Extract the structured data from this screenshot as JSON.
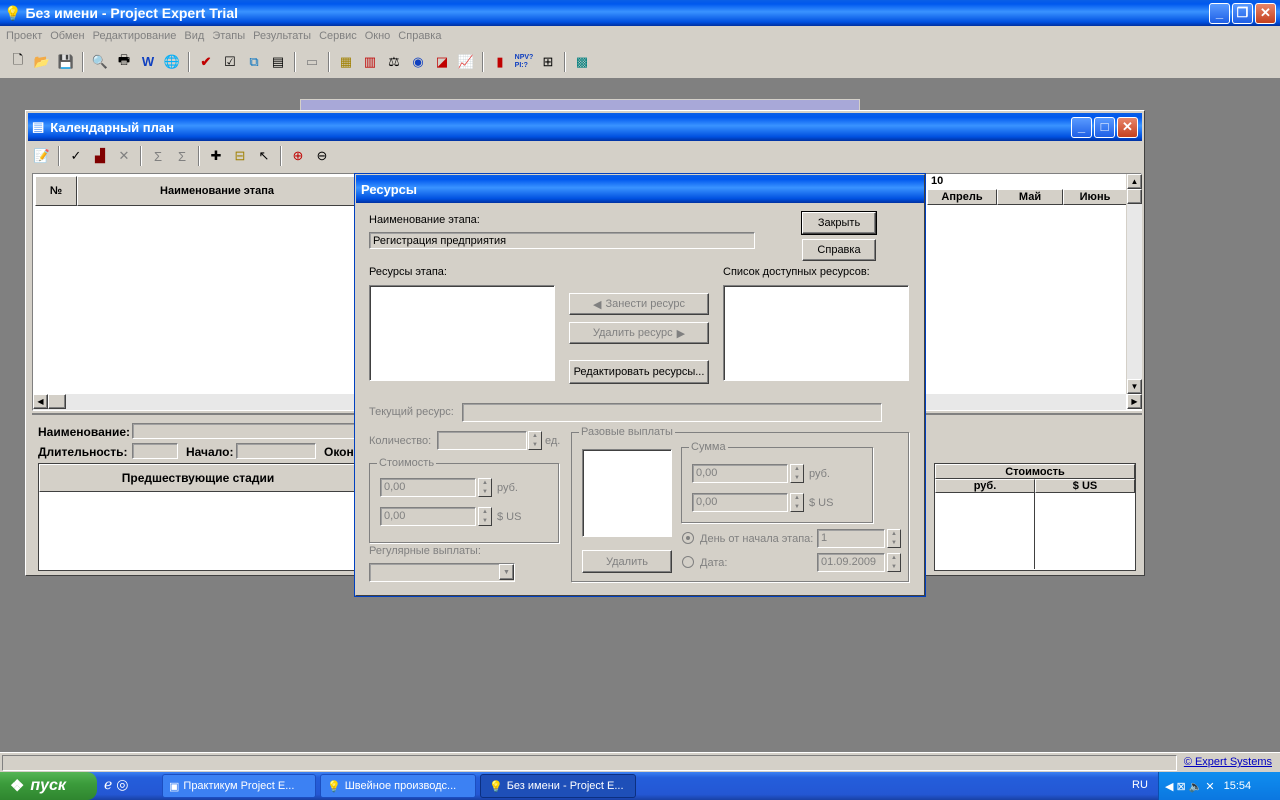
{
  "app": {
    "title": "Без имени - Project Expert Trial"
  },
  "menu": [
    "Проект",
    "Обмен",
    "Редактирование",
    "Вид",
    "Этапы",
    "Результаты",
    "Сервис",
    "Окно",
    "Справка"
  ],
  "calendar": {
    "title": "Календарный план",
    "col_num": "№",
    "col_name": "Наименование этапа",
    "year_fragment": "10",
    "months": [
      "Апрель",
      "Май",
      "Июнь"
    ],
    "name_label": "Наименование:",
    "duration_label": "Длительность:",
    "start_label": "Начало:",
    "end_label_fragment": "Окон",
    "pred_header": "Предшествующие стадии",
    "cost_header": "Стоимость",
    "cost_rub": "руб.",
    "cost_usd": "$ US"
  },
  "resources": {
    "title": "Ресурсы",
    "stage_name_label": "Наименование этапа:",
    "stage_name_value": "Регистрация предприятия",
    "close_btn": "Закрыть",
    "help_btn": "Справка",
    "stage_res_label": "Ресурсы этапа:",
    "avail_label": "Список доступных ресурсов:",
    "add_btn": "Занести ресурс",
    "remove_btn": "Удалить ресурс",
    "edit_btn": "Редактировать ресурсы...",
    "current_label": "Текущий ресурс:",
    "qty_label": "Количество:",
    "qty_unit": "ед.",
    "cost_group": "Стоимость",
    "cost_rub_value": "0,00",
    "cost_rub_unit": "руб.",
    "cost_usd_value": "0,00",
    "cost_usd_unit": "$ US",
    "regular_label": "Регулярные выплаты:",
    "oneoff_group": "Разовые выплаты",
    "sum_group": "Сумма",
    "sum_rub_value": "0,00",
    "sum_rub_unit": "руб.",
    "sum_usd_value": "0,00",
    "sum_usd_unit": "$ US",
    "delete_btn": "Удалить",
    "day_label": "День от начала этапа:",
    "day_value": "1",
    "date_label": "Дата:",
    "date_value": "01.09.2009"
  },
  "status": {
    "link": "© Expert Systems"
  },
  "taskbar": {
    "start": "пуск",
    "items": [
      "Практикум Project E...",
      "Швейное производс...",
      "Без имени - Project E..."
    ],
    "lang": "RU",
    "time": "15:54"
  }
}
